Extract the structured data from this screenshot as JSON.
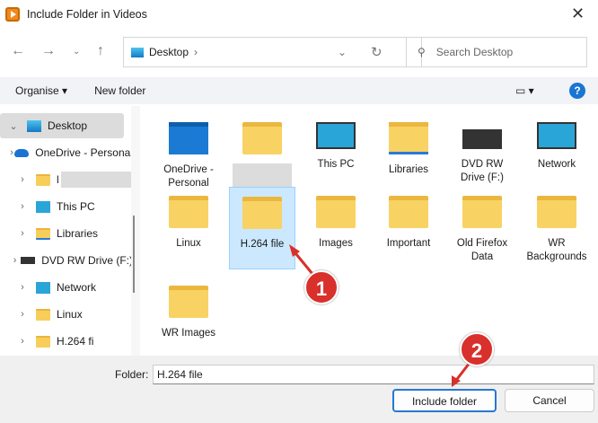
{
  "window": {
    "title": "Include Folder in Videos"
  },
  "address": {
    "location": "Desktop"
  },
  "search": {
    "placeholder": "Search Desktop"
  },
  "toolbar": {
    "organise": "Organise ▾",
    "new_folder": "New folder"
  },
  "sidebar": {
    "items": [
      {
        "label": "Desktop",
        "icon": "desktop-icon",
        "expanded": true
      },
      {
        "label": "OneDrive - Personal",
        "icon": "onedrive-icon"
      },
      {
        "label": "l",
        "icon": "folder-icon"
      },
      {
        "label": "This PC",
        "icon": "pc-icon"
      },
      {
        "label": "Libraries",
        "icon": "libraries-icon"
      },
      {
        "label": "DVD RW Drive (F:)",
        "icon": "dvd-icon"
      },
      {
        "label": "Network",
        "icon": "network-icon"
      },
      {
        "label": "Linux",
        "icon": "folder-icon"
      },
      {
        "label": "H.264 fi",
        "icon": "folder-icon"
      }
    ]
  },
  "items": [
    {
      "label": "OneDrive - Personal",
      "icon": "onedrive-folder-icon"
    },
    {
      "label": "",
      "icon": "folder-icon"
    },
    {
      "label": "This PC",
      "icon": "pc-icon"
    },
    {
      "label": "Libraries",
      "icon": "libraries-icon"
    },
    {
      "label": "DVD RW Drive (F:)",
      "icon": "dvd-icon"
    },
    {
      "label": "Network",
      "icon": "network-icon"
    },
    {
      "label": "Linux",
      "icon": "folder-icon"
    },
    {
      "label": "H.264 file",
      "icon": "folder-icon",
      "selected": true
    },
    {
      "label": "Images",
      "icon": "folder-icon"
    },
    {
      "label": "Important",
      "icon": "folder-icon"
    },
    {
      "label": "Old Firefox Data",
      "icon": "folder-icon"
    },
    {
      "label": "WR Backgrounds",
      "icon": "folder-icon"
    },
    {
      "label": "WR Images",
      "icon": "folder-icon"
    }
  ],
  "footer": {
    "folder_label": "Folder:",
    "folder_value": "H.264 file",
    "include": "Include folder",
    "cancel": "Cancel"
  },
  "annotations": {
    "step1": "1",
    "step2": "2",
    "color": "#d9302c"
  }
}
